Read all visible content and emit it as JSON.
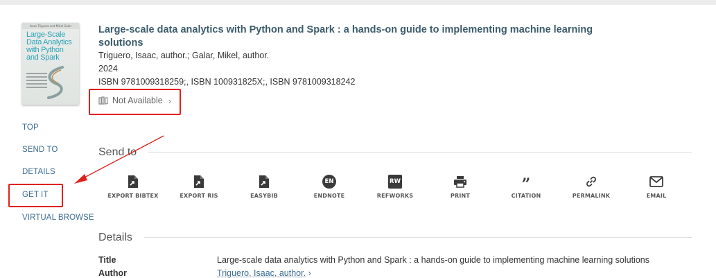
{
  "record": {
    "title": "Large-scale data analytics with Python and Spark : a hands-on guide to implementing machine learning solutions",
    "authors": "Triguero, Isaac, author.; Galar, Mikel, author.",
    "year": "2024",
    "isbn": "ISBN 9781009318259;, ISBN 100931825X;, ISBN 9781009318242",
    "availability": "Not Available",
    "cover": {
      "authors_strip": "Isaac Triguero and Mikel Galar",
      "title_lines": [
        "Large-Scale",
        "Data Analytics",
        "with Python",
        "and Spark"
      ]
    }
  },
  "nav": {
    "items": [
      "TOP",
      "SEND TO",
      "DETAILS",
      "GET IT",
      "VIRTUAL BROWSE"
    ]
  },
  "send_to": {
    "heading": "Send to",
    "actions": [
      {
        "label": "EXPORT BIBTEX",
        "icon": "export-file-icon"
      },
      {
        "label": "EXPORT RIS",
        "icon": "export-file-icon"
      },
      {
        "label": "EASYBIB",
        "icon": "export-file-icon"
      },
      {
        "label": "ENDNOTE",
        "icon": "endnote-icon",
        "badge": "EN"
      },
      {
        "label": "REFWORKS",
        "icon": "refworks-icon",
        "badge": "RW"
      },
      {
        "label": "PRINT",
        "icon": "printer-icon"
      },
      {
        "label": "CITATION",
        "icon": "quote-icon",
        "glyph": "”"
      },
      {
        "label": "PERMALINK",
        "icon": "link-icon"
      },
      {
        "label": "EMAIL",
        "icon": "envelope-icon"
      }
    ]
  },
  "details": {
    "heading": "Details",
    "rows": [
      {
        "label": "Title",
        "value": "Large-scale data analytics with Python and Spark : a hands-on guide to implementing machine learning solutions"
      },
      {
        "label": "Author",
        "value": "Triguero, Isaac, author.",
        "chevron": "›"
      }
    ]
  },
  "ui": {
    "chevron": "›"
  },
  "colors": {
    "title": "#3b5b6b",
    "link": "#3d6e94",
    "highlight": "#e0211c",
    "icon": "#3a3a3a"
  }
}
